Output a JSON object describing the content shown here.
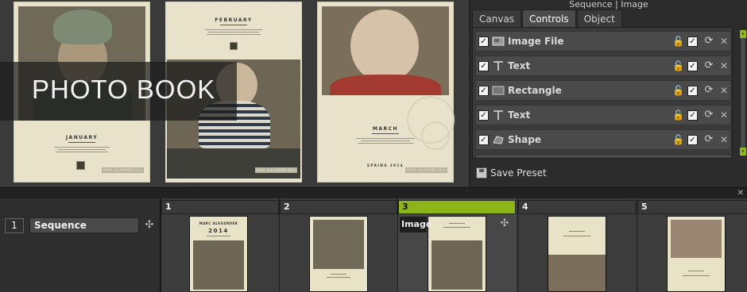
{
  "canvas": {
    "banner_text": "PHOTO BOOK",
    "pages": [
      {
        "month": "JANUARY",
        "footer": "MARC ALEXANDER  2014"
      },
      {
        "month": "FEBRUARY",
        "footer": "MARC ALEXANDER  2014"
      },
      {
        "month": "MARCH",
        "footer": "MARC ALEXANDER  2014",
        "year_text": "SPRING 2014"
      }
    ]
  },
  "panel": {
    "title": "Sequence | Image",
    "tabs": [
      {
        "label": "Canvas",
        "active": false
      },
      {
        "label": "Controls",
        "active": true
      },
      {
        "label": "Object",
        "active": false
      }
    ],
    "layers": [
      {
        "name": "Image File",
        "icon": "image-icon",
        "visible": true
      },
      {
        "name": "Text",
        "icon": "text-icon",
        "visible": true
      },
      {
        "name": "Rectangle",
        "icon": "rectangle-icon",
        "visible": true
      },
      {
        "name": "Text",
        "icon": "text-icon",
        "visible": true
      },
      {
        "name": "Shape",
        "icon": "shape-icon",
        "visible": true
      }
    ],
    "save_preset": "Save Preset",
    "check_glyph": "✓",
    "lock_glyph": "🔓",
    "reset_glyph": "⟳",
    "delete_glyph": "✕"
  },
  "timeline": {
    "sequence_number": "1",
    "sequence_name": "Sequence",
    "slots": [
      {
        "number": "1",
        "active": false
      },
      {
        "number": "2",
        "active": false
      },
      {
        "number": "3",
        "active": true
      },
      {
        "number": "4",
        "active": false
      },
      {
        "number": "5",
        "active": false
      }
    ],
    "active_label": "Image",
    "thumb_texts": {
      "slot1_title": "MARC ALEXANDER",
      "slot1_year": "2014"
    }
  },
  "colors": {
    "accent": "#8cb51a",
    "page_bg": "#e7e2c9",
    "panel_bg": "#2c2c2c"
  }
}
